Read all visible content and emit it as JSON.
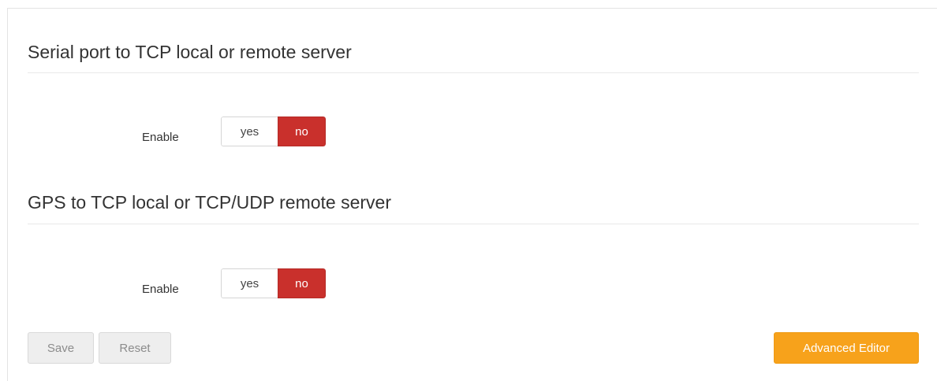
{
  "sections": [
    {
      "title": "Serial port to TCP local or remote server",
      "enable": {
        "label": "Enable",
        "options": [
          "yes",
          "no"
        ],
        "selected": "no"
      }
    },
    {
      "title": "GPS to TCP local or TCP/UDP remote server",
      "enable": {
        "label": "Enable",
        "options": [
          "yes",
          "no"
        ],
        "selected": "no"
      }
    }
  ],
  "actions": {
    "save_label": "Save",
    "reset_label": "Reset",
    "advanced_editor_label": "Advanced Editor"
  },
  "colors": {
    "selected_no": "#c9302c",
    "advanced_editor": "#f7a21b"
  }
}
